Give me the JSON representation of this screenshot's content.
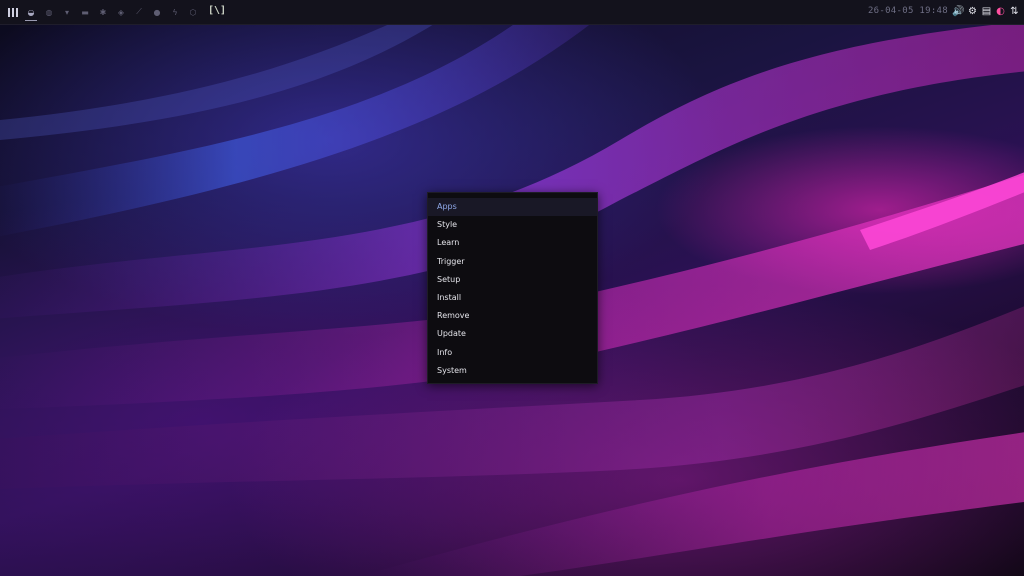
{
  "topbar": {
    "workspaces": [
      {
        "icon": "moon-icon",
        "glyph": "◒",
        "active": true
      },
      {
        "icon": "globe-icon",
        "glyph": "◍",
        "active": false
      },
      {
        "icon": "chat-icon",
        "glyph": "▾",
        "active": false
      },
      {
        "icon": "mail-icon",
        "glyph": "▬",
        "active": false
      },
      {
        "icon": "bug-icon",
        "glyph": "✱",
        "active": false
      },
      {
        "icon": "shield-icon",
        "glyph": "◈",
        "active": false
      },
      {
        "icon": "wrench-icon",
        "glyph": "⟋",
        "active": false
      },
      {
        "icon": "drop-icon",
        "glyph": "●",
        "active": false
      },
      {
        "icon": "bolt-icon",
        "glyph": "ϟ",
        "active": false
      },
      {
        "icon": "hexagon-icon",
        "glyph": "⬡",
        "active": false
      }
    ],
    "layout_indicator": "[\\]",
    "clock": "26-04-05 19:48",
    "tray": [
      {
        "icon": "volume-icon",
        "glyph": "🔊"
      },
      {
        "icon": "settings-gear-icon",
        "glyph": "⚙"
      },
      {
        "icon": "clipboard-icon",
        "glyph": "▤"
      },
      {
        "icon": "colorful-app-icon",
        "glyph": "◐"
      },
      {
        "icon": "network-arrows-icon",
        "glyph": "⇅"
      }
    ]
  },
  "menu": {
    "selected_index": 0,
    "items": [
      "Apps",
      "Style",
      "Learn",
      "Trigger",
      "Setup",
      "Install",
      "Remove",
      "Update",
      "Info",
      "System"
    ]
  },
  "colors": {
    "bar_bg": "#13121c",
    "menu_bg": "#0d0c10",
    "menu_selected_text": "#8fa8e8",
    "accent_pink": "#ff2ec4",
    "accent_purple": "#7a2bd6"
  }
}
